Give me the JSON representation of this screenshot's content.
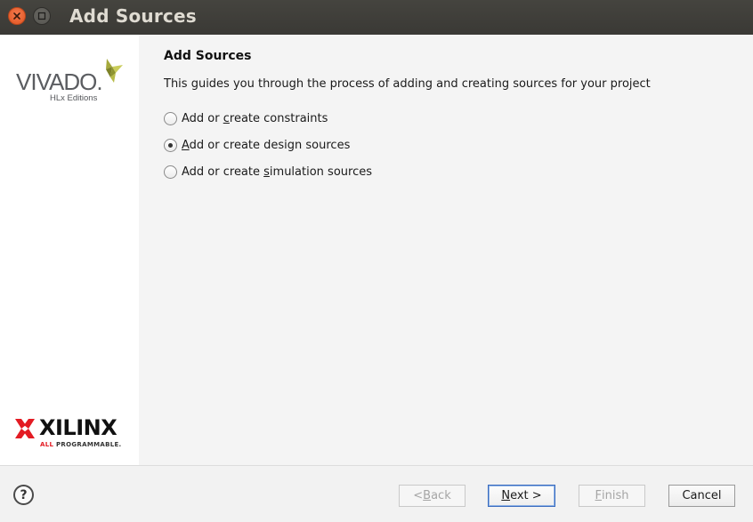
{
  "window": {
    "title": "Add Sources"
  },
  "sidebar": {
    "vivado_logo_text": "VIVADO.",
    "vivado_logo_sub": "HLx Editions",
    "xilinx_logo_text": "XILINX",
    "xilinx_tagline_red": "ALL",
    "xilinx_tagline_rest": "PROGRAMMABLE."
  },
  "main": {
    "heading": "Add Sources",
    "description": "This guides you through the process of adding and creating sources for your project",
    "options": [
      {
        "pre": "Add or ",
        "mnemonic": "c",
        "post": "reate constraints",
        "checked": false
      },
      {
        "pre": "",
        "mnemonic": "A",
        "post": "dd or create design sources",
        "checked": true
      },
      {
        "pre": "Add or create ",
        "mnemonic": "s",
        "post": "imulation sources",
        "checked": false
      }
    ]
  },
  "footer": {
    "help_label": "?",
    "back": {
      "pre": "< ",
      "mnemonic": "B",
      "post": "ack",
      "enabled": false
    },
    "next": {
      "pre": "",
      "mnemonic": "N",
      "post": "ext >",
      "enabled": true
    },
    "finish": {
      "pre": "",
      "mnemonic": "F",
      "post": "inish",
      "enabled": false
    },
    "cancel": {
      "label": "Cancel",
      "enabled": true
    }
  },
  "colors": {
    "titlebar": "#3d3c38",
    "close_button": "#e9602f",
    "primary_button_border": "#3a6cbf",
    "xilinx_red": "#e31b23",
    "vivado_green": "#a2a83a"
  }
}
